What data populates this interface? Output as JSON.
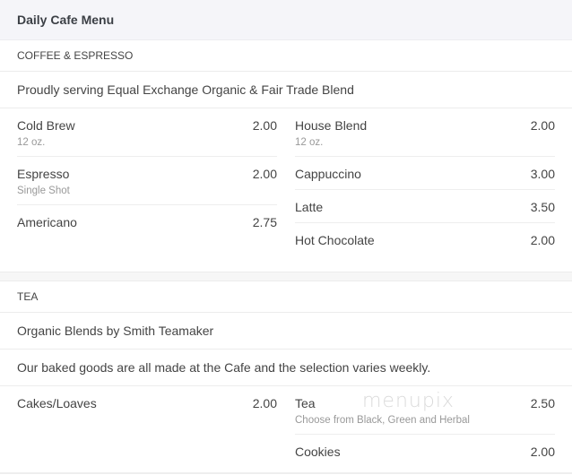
{
  "header": {
    "title": "Daily Cafe Menu"
  },
  "sections": [
    {
      "name": "COFFEE & ESPRESSO",
      "descriptions": [
        "Proudly serving Equal Exchange Organic & Fair Trade Blend"
      ],
      "left_items": [
        {
          "name": "Cold Brew",
          "desc": "12 oz.",
          "price": "2.00"
        },
        {
          "name": "Espresso",
          "desc": "Single Shot",
          "price": "2.00"
        },
        {
          "name": "Americano",
          "desc": "",
          "price": "2.75"
        }
      ],
      "right_items": [
        {
          "name": "House Blend",
          "desc": "12 oz.",
          "price": "2.00"
        },
        {
          "name": "Cappuccino",
          "desc": "",
          "price": "3.00"
        },
        {
          "name": "Latte",
          "desc": "",
          "price": "3.50"
        },
        {
          "name": "Hot Chocolate",
          "desc": "",
          "price": "2.00"
        }
      ]
    },
    {
      "name": "TEA",
      "descriptions": [
        "Organic Blends by Smith Teamaker",
        "Our baked goods are all made at the Cafe and the selection varies weekly."
      ],
      "left_items": [
        {
          "name": "Cakes/Loaves",
          "desc": "",
          "price": "2.00"
        }
      ],
      "right_items": [
        {
          "name": "Tea",
          "desc": "Choose from Black, Green and Herbal",
          "price": "2.50"
        },
        {
          "name": "Cookies",
          "desc": "",
          "price": "2.00"
        }
      ]
    }
  ],
  "watermark": "menupix"
}
